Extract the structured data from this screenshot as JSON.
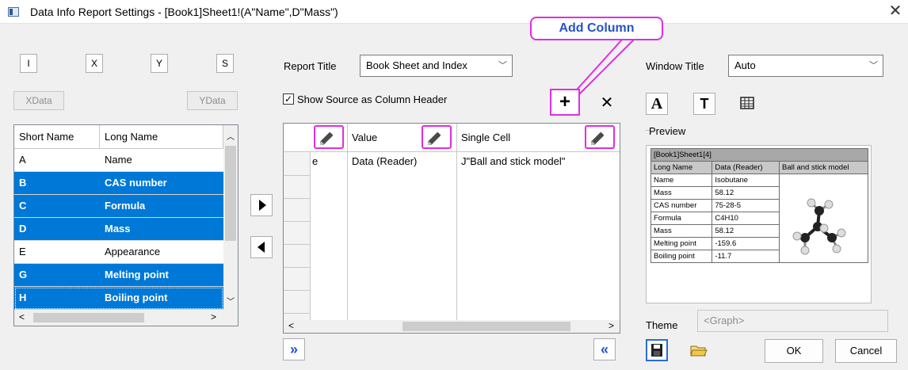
{
  "window": {
    "title": "Data Info Report Settings - [Book1]Sheet1!(A\"Name\",D\"Mass\")",
    "close": "✕"
  },
  "callout": {
    "label": "Add Column"
  },
  "left": {
    "buttons": [
      "I",
      "X",
      "Y",
      "S"
    ],
    "xdata_label": "XData",
    "ydata_label": "YData",
    "columns": [
      "Short Name",
      "Long Name"
    ],
    "rows": [
      {
        "short": "A",
        "long": "Name",
        "selected": false
      },
      {
        "short": "B",
        "long": "CAS number",
        "selected": true
      },
      {
        "short": "C",
        "long": "Formula",
        "selected": true
      },
      {
        "short": "D",
        "long": "Mass",
        "selected": true
      },
      {
        "short": "E",
        "long": "Appearance",
        "selected": false
      },
      {
        "short": "G",
        "long": "Melting point",
        "selected": true
      },
      {
        "short": "H",
        "long": "Boiling point",
        "selected": true
      }
    ]
  },
  "middle": {
    "report_title_label": "Report Title",
    "report_title_value": "Book Sheet and Index",
    "show_source_label": "Show Source as Column Header",
    "add_glyph": "+",
    "delete_glyph": "✕",
    "columns": [
      "Value",
      "Single Cell"
    ],
    "first_row": {
      "partial": "e",
      "value": "Data (Reader)",
      "single_cell": "J\"Ball and stick model\""
    },
    "expand_glyph": "»",
    "collapse_glyph": "«"
  },
  "right": {
    "window_title_label": "Window Title",
    "window_title_value": "Auto",
    "preview_label": "Preview",
    "preview_sheet": "[Book1]Sheet1[4]",
    "preview_headers": [
      "Long Name",
      "Data (Reader)",
      "Ball and stick model"
    ],
    "preview_rows": [
      [
        "Name",
        "Isobutane"
      ],
      [
        "Mass",
        "58.12"
      ],
      [
        "CAS number",
        "75-28-5"
      ],
      [
        "Formula",
        "C4H10"
      ],
      [
        "Mass",
        "58.12"
      ],
      [
        "Melting point",
        "-159.6"
      ],
      [
        "Boiling point",
        "-11.7"
      ]
    ],
    "theme_label": "Theme",
    "theme_placeholder": "<Graph>",
    "ok_label": "OK",
    "cancel_label": "Cancel"
  },
  "colors": {
    "selection": "#0078d7",
    "highlight": "#e02ee0",
    "callout_text": "#2453c8"
  }
}
